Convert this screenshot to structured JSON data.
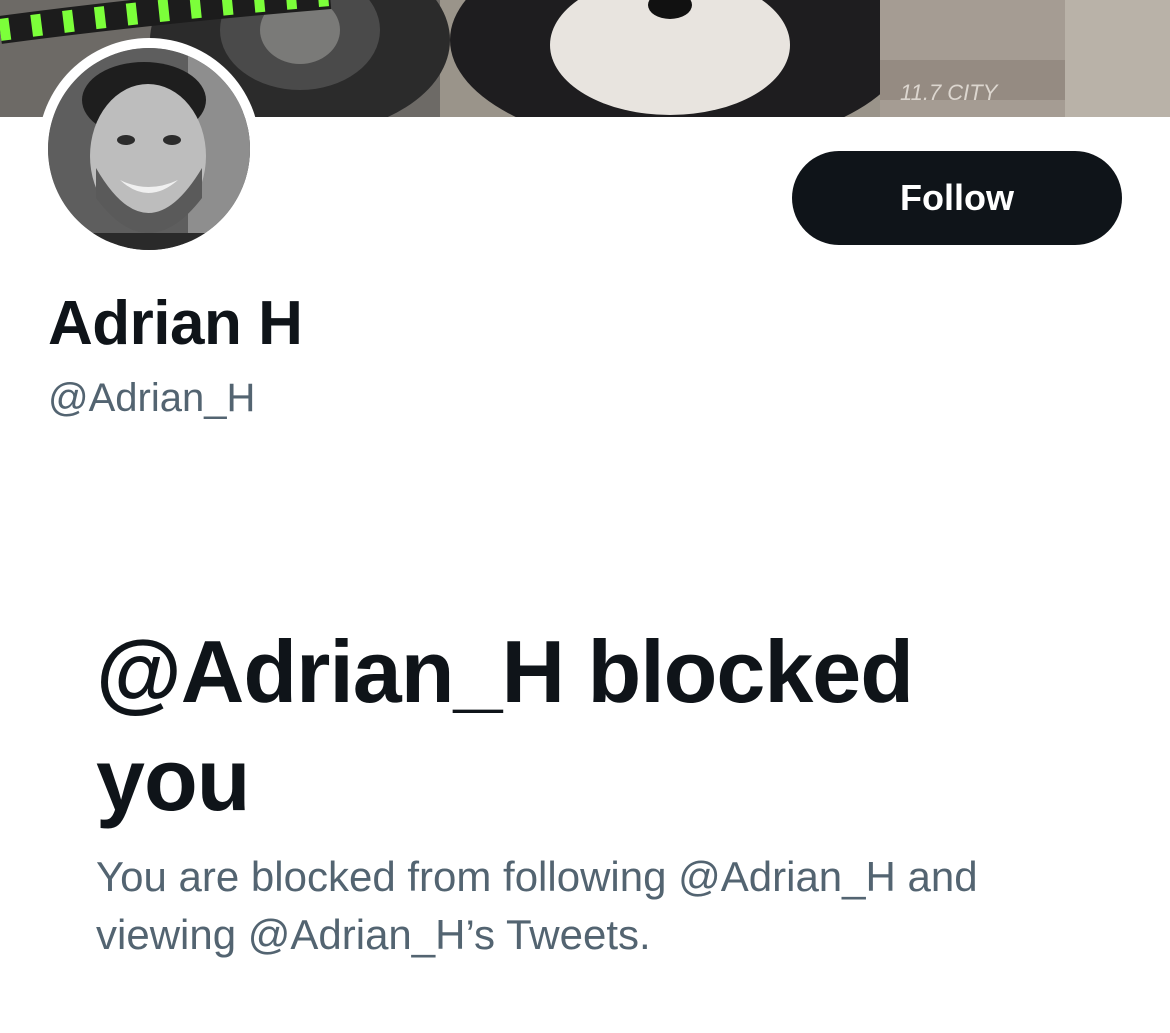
{
  "profile": {
    "display_name": "Adrian H",
    "handle": "@Adrian_H",
    "follow_label": "Follow"
  },
  "blocked_notice": {
    "title": "@Adrian_H blocked you",
    "body": "You are blocked from following @Adrian_H and viewing @Adrian_H’s Tweets."
  },
  "banner": {
    "can_text": "11.7 CITY"
  },
  "colors": {
    "primary_text": "#0f1419",
    "secondary_text": "#536471",
    "button_bg": "#0f1419",
    "button_text": "#ffffff",
    "background": "#ffffff"
  }
}
